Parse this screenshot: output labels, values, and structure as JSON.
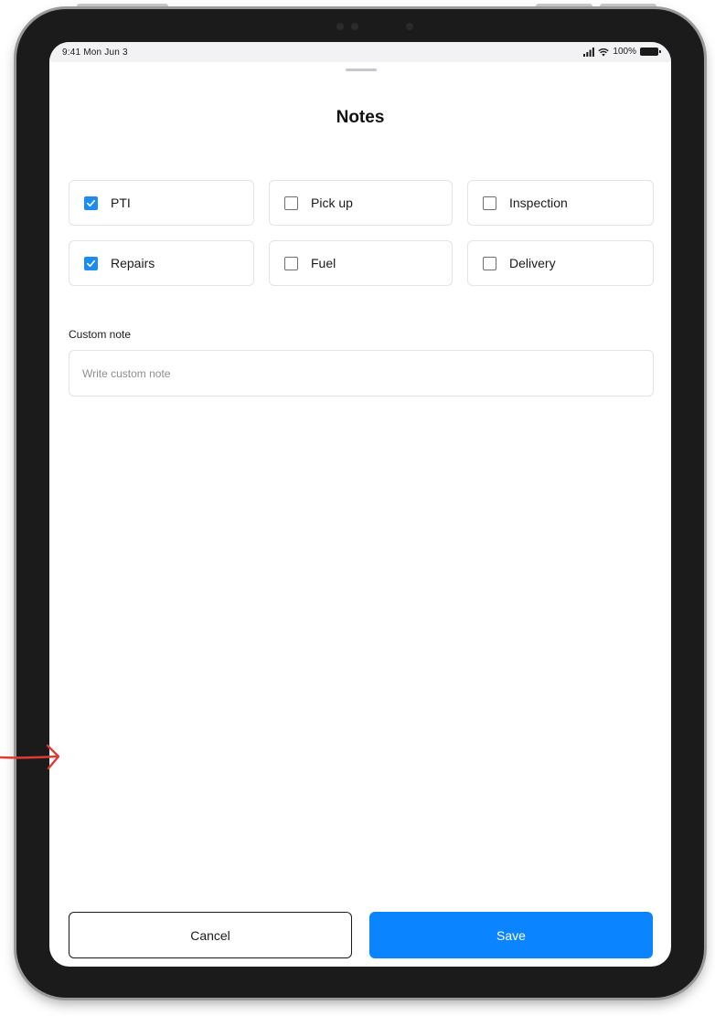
{
  "status_bar": {
    "time": "9:41 Mon Jun 3",
    "battery": "100%"
  },
  "sheet": {
    "title": "Notes"
  },
  "options": [
    {
      "label": "PTI",
      "checked": true
    },
    {
      "label": "Pick up",
      "checked": false
    },
    {
      "label": "Inspection",
      "checked": false
    },
    {
      "label": "Repairs",
      "checked": true
    },
    {
      "label": "Fuel",
      "checked": false
    },
    {
      "label": "Delivery",
      "checked": false
    }
  ],
  "custom_note": {
    "label": "Custom note",
    "placeholder": "Write custom note",
    "value": ""
  },
  "actions": {
    "cancel_label": "Cancel",
    "save_label": "Save"
  },
  "colors": {
    "accent": "#0b84ff",
    "checkbox_checked": "#1d8cf0",
    "annotation_arrow": "#e03a36"
  }
}
